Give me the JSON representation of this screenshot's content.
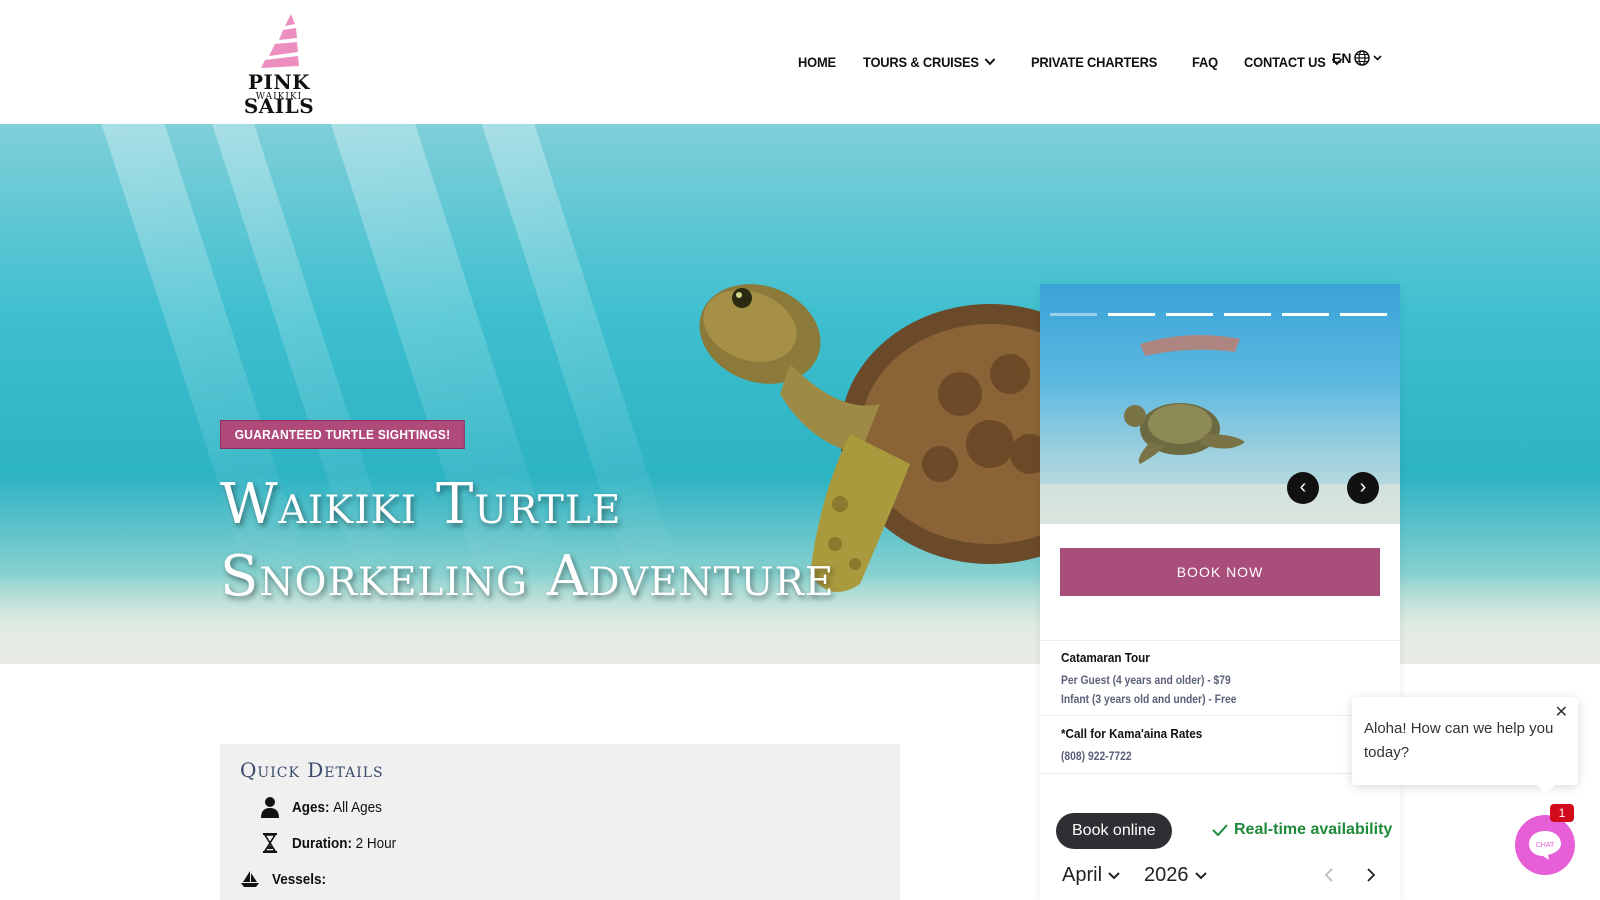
{
  "brand": {
    "name": "PINK SAILS",
    "location": "WAIKIKI",
    "accent": "#a94d7b",
    "logo_pink": "#ec8fc0"
  },
  "nav": {
    "items": [
      {
        "label": "HOME",
        "dropdown": false
      },
      {
        "label": "TOURS & CRUISES",
        "dropdown": true
      },
      {
        "label": "PRIVATE CHARTERS",
        "dropdown": false
      },
      {
        "label": "FAQ",
        "dropdown": false
      },
      {
        "label": "CONTACT US",
        "dropdown": true
      }
    ],
    "language": "EN"
  },
  "hero": {
    "badge": "GUARANTEED TURTLE SIGHTINGS!",
    "title_line1": "Waikiki Turtle",
    "title_line2": "Snorkeling Adventure"
  },
  "booking": {
    "slides_total": 6,
    "slide_active": 1,
    "prev_label": "‹",
    "next_label": "›",
    "book_now": "BOOK NOW",
    "pricing": {
      "title": "Catamaran Tour",
      "lines": [
        "Per Guest (4 years and older) - $79",
        "Infant (3 years old and under) - Free"
      ]
    },
    "kamaaina": {
      "title": "*Call for Kama'aina Rates",
      "phone": "(808) 922-7722"
    },
    "book_online": "Book online",
    "realtime": "Real-time availability",
    "month": "April",
    "year": "2026"
  },
  "quick_details": {
    "title": "Quick Details",
    "rows": [
      {
        "key": "Ages:",
        "value": "All Ages",
        "icon": "person-icon"
      },
      {
        "key": "Duration:",
        "value": "2 Hour",
        "icon": "hourglass-icon"
      },
      {
        "key": "Vessels:",
        "value": "",
        "icon": "sailboat-icon"
      }
    ]
  },
  "chat": {
    "message": "Aloha! How can we help you today?",
    "button_label": "CHAT",
    "unread": "1",
    "color": "#e65fd7"
  }
}
